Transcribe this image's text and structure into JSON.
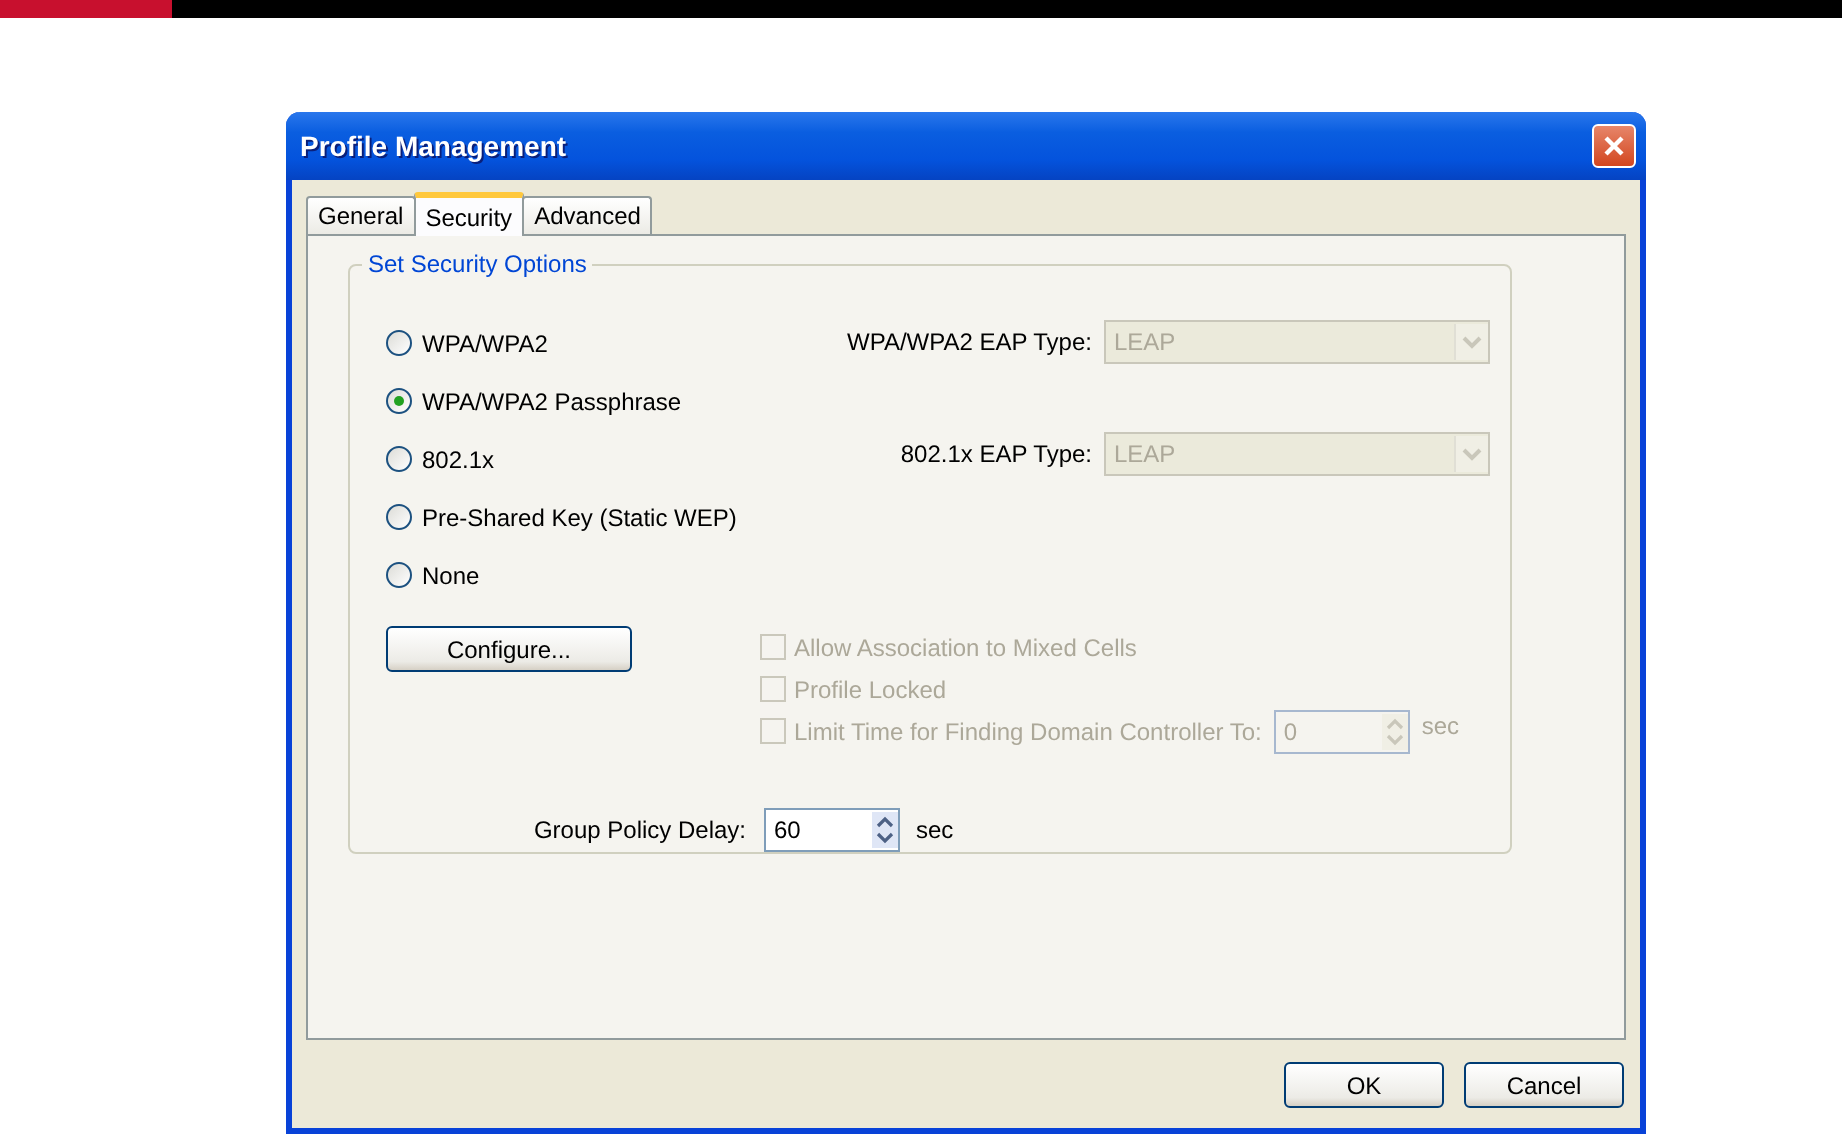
{
  "window": {
    "title": "Profile Management"
  },
  "tabs": [
    {
      "label": "General",
      "selected": false
    },
    {
      "label": "Security",
      "selected": true
    },
    {
      "label": "Advanced",
      "selected": false
    }
  ],
  "security_group": {
    "title": "Set Security Options",
    "options": [
      {
        "label": "WPA/WPA2",
        "selected": false
      },
      {
        "label": "WPA/WPA2 Passphrase",
        "selected": true
      },
      {
        "label": "802.1x",
        "selected": false
      },
      {
        "label": "Pre-Shared Key (Static WEP)",
        "selected": false
      },
      {
        "label": "None",
        "selected": false
      }
    ],
    "eap_types": [
      {
        "label": "WPA/WPA2 EAP Type:",
        "value": "LEAP",
        "disabled": true
      },
      {
        "label": "802.1x EAP Type:",
        "value": "LEAP",
        "disabled": true
      }
    ],
    "configure_button": "Configure...",
    "checkboxes": [
      {
        "label": "Allow Association to Mixed Cells",
        "checked": false,
        "disabled": true
      },
      {
        "label": "Profile Locked",
        "checked": false,
        "disabled": true
      },
      {
        "label": "Limit Time for Finding Domain Controller To:",
        "checked": false,
        "disabled": true,
        "field": {
          "value": "0",
          "unit": "sec"
        }
      }
    ],
    "group_policy": {
      "label": "Group Policy Delay:",
      "value": "60",
      "unit": "sec"
    }
  },
  "buttons": [
    "OK",
    "Cancel"
  ]
}
